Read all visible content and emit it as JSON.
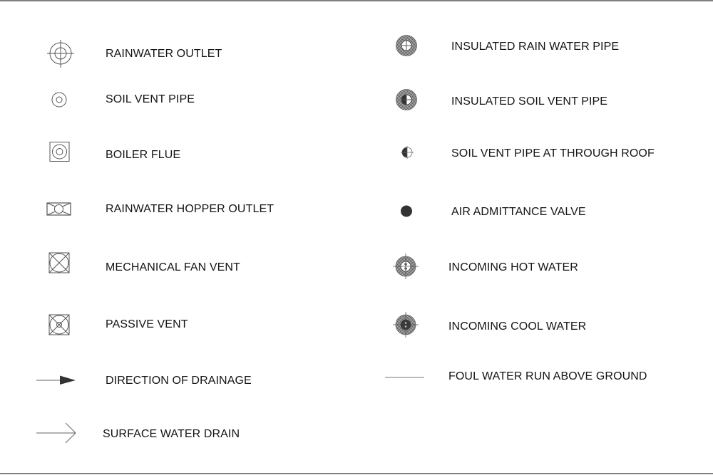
{
  "legend": {
    "left_column": [
      {
        "symbol": "rainwater-outlet-icon",
        "label": "RAINWATER OUTLET"
      },
      {
        "symbol": "soil-vent-pipe-icon",
        "label": "SOIL VENT PIPE"
      },
      {
        "symbol": "boiler-flue-icon",
        "label": "BOILER FLUE"
      },
      {
        "symbol": "rainwater-hopper-outlet-icon",
        "label": "RAINWATER HOPPER OUTLET"
      },
      {
        "symbol": "mechanical-fan-vent-icon",
        "label": "MECHANICAL FAN VENT"
      },
      {
        "symbol": "passive-vent-icon",
        "label": "PASSIVE VENT"
      },
      {
        "symbol": "direction-of-drainage-icon",
        "label": "DIRECTION OF DRAINAGE"
      },
      {
        "symbol": "surface-water-drain-icon",
        "label": "SURFACE WATER DRAIN"
      }
    ],
    "right_column": [
      {
        "symbol": "insulated-rain-water-pipe-icon",
        "label": "INSULATED RAIN WATER PIPE"
      },
      {
        "symbol": "insulated-soil-vent-pipe-icon",
        "label": "INSULATED SOIL VENT PIPE"
      },
      {
        "symbol": "soil-vent-pipe-through-roof-icon",
        "label": "SOIL VENT PIPE AT THROUGH ROOF"
      },
      {
        "symbol": "air-admittance-valve-icon",
        "label": "AIR ADMITTANCE VALVE"
      },
      {
        "symbol": "incoming-hot-water-icon",
        "label": "INCOMING HOT WATER"
      },
      {
        "symbol": "incoming-cool-water-icon",
        "label": "INCOMING COOL WATER"
      },
      {
        "symbol": "foul-water-run-above-ground-icon",
        "label": "FOUL WATER RUN ABOVE GROUND"
      }
    ]
  },
  "colors": {
    "line": "#555555",
    "fill_dark": "#333333",
    "hatch": "#8a8a8a",
    "text": "#141414",
    "frame": "#7f7f7f"
  }
}
